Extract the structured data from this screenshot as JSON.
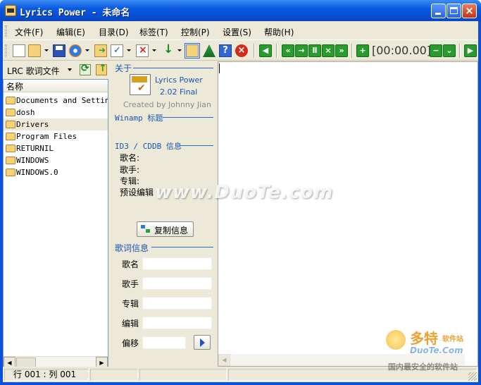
{
  "window": {
    "title": "Lyrics Power - 未命名"
  },
  "menu": [
    "文件(F)",
    "编辑(E)",
    "目录(D)",
    "标签(T)",
    "控制(P)",
    "设置(S)",
    "帮助(H)"
  ],
  "toolbar": {
    "time_readout": "[00:00.00]"
  },
  "file_browser": {
    "filter_label": "LRC 歌词文件",
    "column_header": "名称",
    "items": [
      "Documents and Settings",
      "dosh",
      "Drivers",
      "Program Files",
      "RETURNIL",
      "WINDOWS",
      "WINDOWS.0"
    ],
    "selected_index": 2
  },
  "about": {
    "section_title": "关于",
    "app_name": "Lyrics Power",
    "version": "2.02 Final",
    "author": "Created by Johnny Jian"
  },
  "winamp": {
    "section_title": "Winamp 标题"
  },
  "id3": {
    "section_title": "ID3 / CDDB 信息",
    "labels": [
      "歌名:",
      "歌手:",
      "专辑:",
      "预设编辑"
    ],
    "copy_button": "复制信息"
  },
  "lyrics_info": {
    "section_title": "歌词信息",
    "fields": [
      {
        "label": "歌名",
        "value": ""
      },
      {
        "label": "歌手",
        "value": ""
      },
      {
        "label": "专辑",
        "value": ""
      },
      {
        "label": "编辑",
        "value": ""
      },
      {
        "label": "偏移",
        "value": ""
      }
    ]
  },
  "status": {
    "position": "行 001 : 列 001"
  },
  "watermark": {
    "text": "www.DuoTe.com",
    "logo_cn": "多特",
    "logo_cn_small": "软件站",
    "logo_en": "DuoTe.Com",
    "logo_tag": "国内最安全的软件站"
  },
  "colors": {
    "accent": "#1a55b0",
    "title_bar": "#0a5ae0",
    "green_button": "#2a9c2e",
    "panel": "#ece9d8"
  }
}
